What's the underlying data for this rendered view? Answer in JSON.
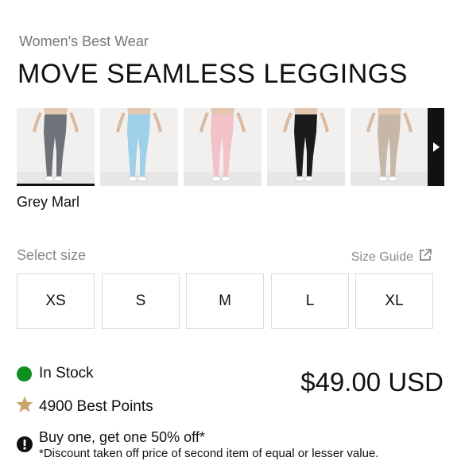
{
  "product": {
    "brand": "Women's Best Wear",
    "title": "MOVE SEAMLESS LEGGINGS",
    "selected_color": "Grey Marl",
    "gallery": [
      {
        "color_name": "Grey Marl",
        "color": "#6f7379",
        "selected": true
      },
      {
        "color_name": "Sky Blue",
        "color": "#9fd0ea",
        "selected": false
      },
      {
        "color_name": "Pink",
        "color": "#f2c2c8",
        "selected": false
      },
      {
        "color_name": "Black",
        "color": "#1b1b1b",
        "selected": false
      },
      {
        "color_name": "Beige",
        "color": "#c7b7a6",
        "selected": false
      }
    ],
    "gallery_next_icon": "chevron-right-icon"
  },
  "sizes": {
    "label": "Select size",
    "guide_label": "Size Guide",
    "guide_icon": "external-link-icon",
    "options": [
      "XS",
      "S",
      "M",
      "L",
      "XL"
    ]
  },
  "stock": {
    "label": "In Stock",
    "color": "#0f8f1f"
  },
  "points": {
    "label": "4900 Best Points",
    "icon": "star-icon",
    "color": "#c9a46c"
  },
  "price": "$49.00 USD",
  "promo": {
    "icon": "alert-icon",
    "headline": "Buy one, get one 50% off*",
    "note": "*Discount taken off price of second item of equal or lesser value."
  }
}
